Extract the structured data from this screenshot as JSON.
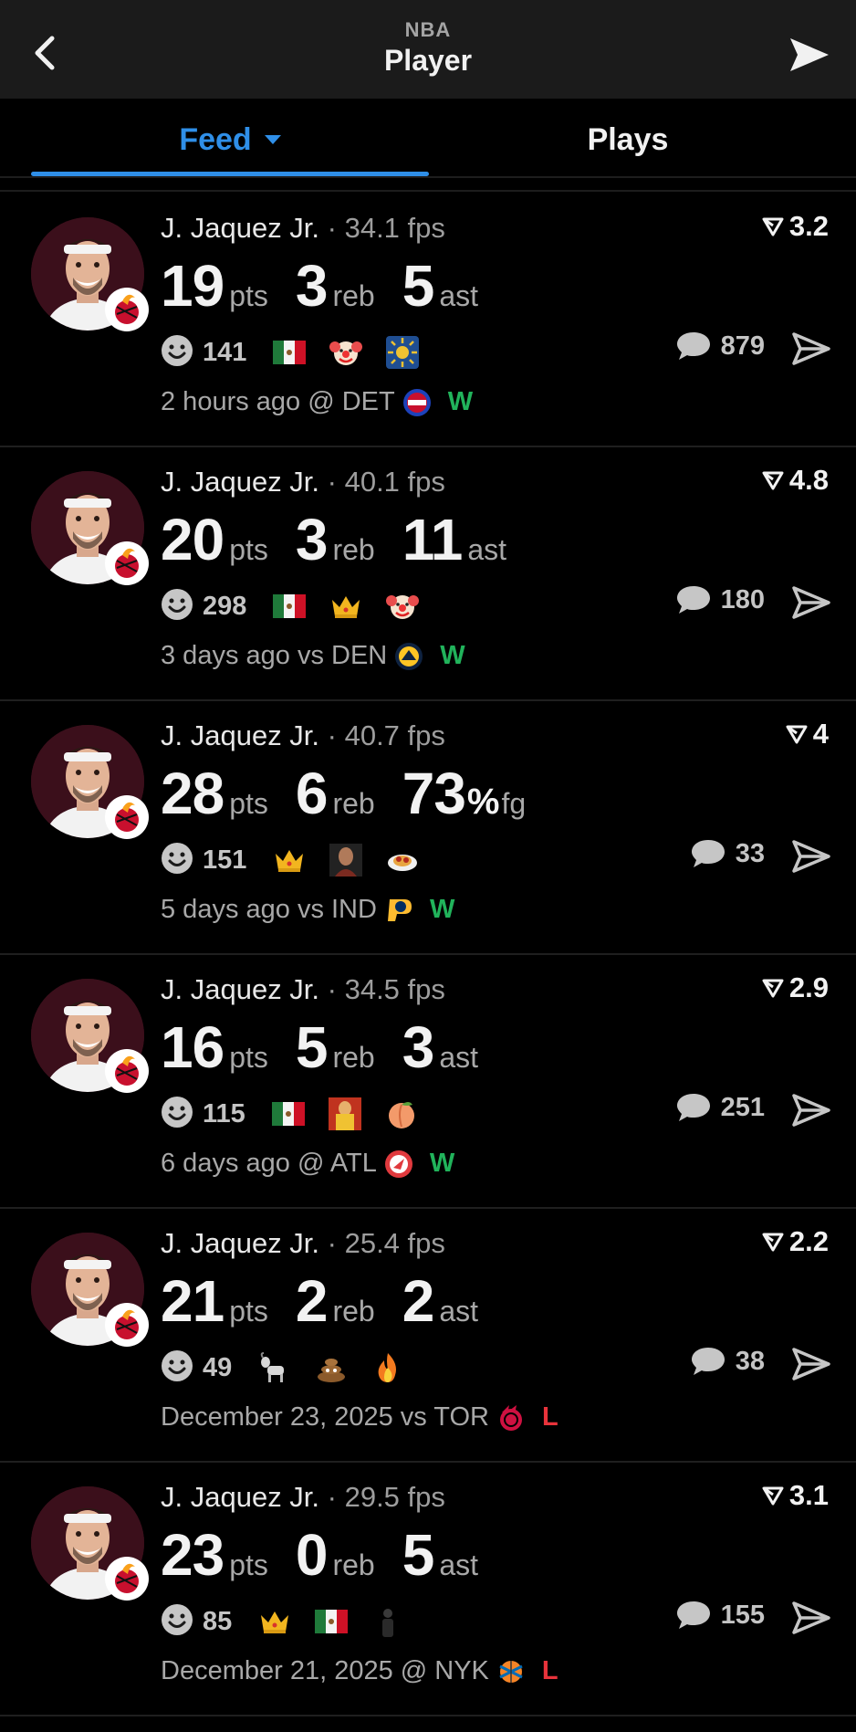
{
  "header": {
    "league": "NBA",
    "title": "Player"
  },
  "tabs": {
    "feed": "Feed",
    "plays": "Plays"
  },
  "colors": {
    "accent": "#2f8fe8",
    "win": "#21b35b",
    "loss": "#e8333b",
    "background": "#000000",
    "header": "#1b1b1b"
  },
  "cards": [
    {
      "name": "J. Jaquez Jr.",
      "fps": "· 34.1 fps",
      "rating": "3.2",
      "s1": "19",
      "u1": "pts",
      "s2": "3",
      "u2": "reb",
      "s3": "5",
      "u3": "ast",
      "reactions": "141",
      "emojis": [
        "mexico-flag",
        "clown-face",
        "sun-tile"
      ],
      "comments": "879",
      "when": "2 hours ago @ DET",
      "opponent_logo": "pistons-logo",
      "result": "W"
    },
    {
      "name": "J. Jaquez Jr.",
      "fps": "· 40.1 fps",
      "rating": "4.8",
      "s1": "20",
      "u1": "pts",
      "s2": "3",
      "u2": "reb",
      "s3": "11",
      "u3": "ast",
      "reactions": "298",
      "emojis": [
        "mexico-flag",
        "crown",
        "clown-face"
      ],
      "comments": "180",
      "when": "3 days ago vs DEN",
      "opponent_logo": "nuggets-logo",
      "result": "W"
    },
    {
      "name": "J. Jaquez Jr.",
      "fps": "· 40.7 fps",
      "rating": "4",
      "s1": "28",
      "u1": "pts",
      "s2": "6",
      "u2": "reb",
      "s3": "73",
      "pct": "%",
      "u3": "fg",
      "reactions": "151",
      "emojis": [
        "crown",
        "player-photo",
        "spaghetti"
      ],
      "comments": "33",
      "when": "5 days ago vs IND",
      "opponent_logo": "pacers-logo",
      "result": "W"
    },
    {
      "name": "J. Jaquez Jr.",
      "fps": "· 34.5 fps",
      "rating": "2.9",
      "s1": "16",
      "u1": "pts",
      "s2": "5",
      "u2": "reb",
      "s3": "3",
      "u3": "ast",
      "reactions": "115",
      "emojis": [
        "mexico-flag",
        "wrestler",
        "peach"
      ],
      "comments": "251",
      "when": "6 days ago @ ATL",
      "opponent_logo": "hawks-logo",
      "result": "W"
    },
    {
      "name": "J. Jaquez Jr.",
      "fps": "· 25.4 fps",
      "rating": "2.2",
      "s1": "21",
      "u1": "pts",
      "s2": "2",
      "u2": "reb",
      "s3": "2",
      "u3": "ast",
      "reactions": "49",
      "emojis": [
        "goat",
        "poop",
        "fire"
      ],
      "comments": "38",
      "when": "December 23, 2025 vs TOR",
      "opponent_logo": "raptors-logo",
      "result": "L"
    },
    {
      "name": "J. Jaquez Jr.",
      "fps": "· 29.5 fps",
      "rating": "3.1",
      "s1": "23",
      "u1": "pts",
      "s2": "0",
      "u2": "reb",
      "s3": "5",
      "u3": "ast",
      "reactions": "85",
      "emojis": [
        "crown",
        "mexico-flag",
        "person-silhouette"
      ],
      "comments": "155",
      "when": "December 21, 2025 @ NYK",
      "opponent_logo": "knicks-logo",
      "result": "L"
    }
  ]
}
